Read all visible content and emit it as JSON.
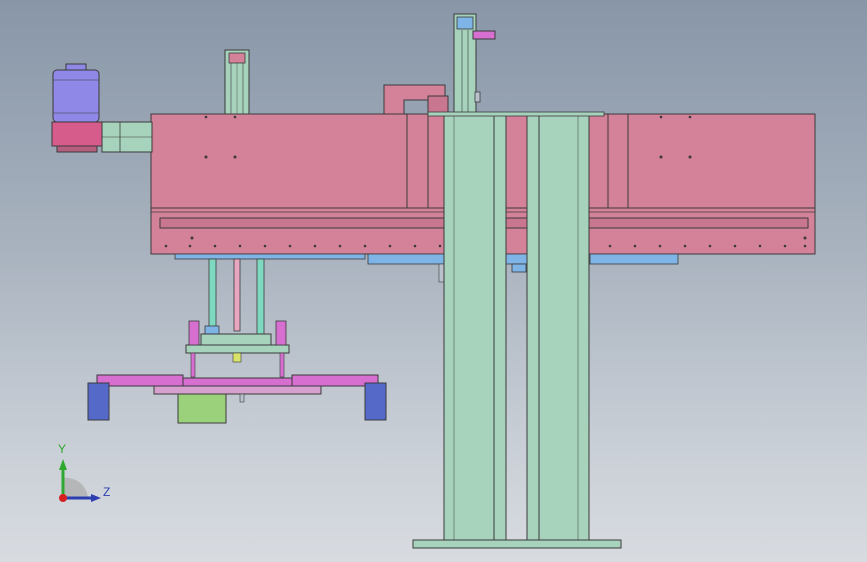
{
  "view": {
    "background_top": "#8896a8",
    "background_bottom": "#d8dce1"
  },
  "triad": {
    "y_label": "Y",
    "z_label": "Z",
    "y_color": "#2ea82e",
    "z_color": "#2d3fb0",
    "origin_color": "#d62020"
  },
  "colors": {
    "frame_pink": "#d4829a",
    "column_green": "#a7d3bd",
    "rail_blue": "#7fb4e6",
    "gripper_magenta": "#d66fd0",
    "pad_blue": "#5569c9",
    "motor_lavender": "#8f88e6",
    "cylinder_green": "#9bd17a",
    "guide_teal": "#7fd9c0",
    "outline": "#3a3a3a"
  }
}
